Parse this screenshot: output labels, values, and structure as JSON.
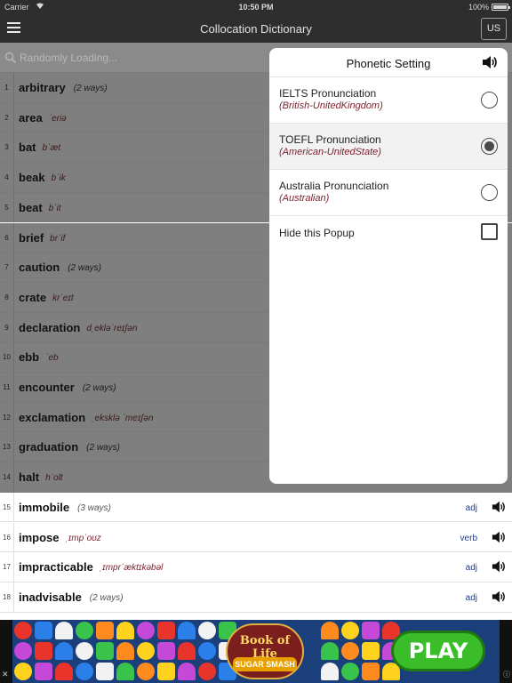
{
  "status_bar": {
    "carrier": "Carrier",
    "time": "10:50 PM",
    "battery": "100%"
  },
  "nav": {
    "title": "Collocation Dictionary",
    "locale_button": "US"
  },
  "search": {
    "placeholder": "Randomly Loading..."
  },
  "entries": [
    {
      "num": "1",
      "word": "arbitrary",
      "ways": "(2 ways)"
    },
    {
      "num": "2",
      "word": "area",
      "phonetic": "ˈeriə"
    },
    {
      "num": "3",
      "word": "bat",
      "phonetic": "bˈæt"
    },
    {
      "num": "4",
      "word": "beak",
      "phonetic": "bˈik"
    },
    {
      "num": "5",
      "word": "beat",
      "phonetic": "bˈit"
    },
    {
      "num": "6",
      "word": "brief",
      "phonetic": "brˈif"
    },
    {
      "num": "7",
      "word": "caution",
      "ways": "(2 ways)"
    },
    {
      "num": "8",
      "word": "crate",
      "phonetic": "krˈeɪt"
    },
    {
      "num": "9",
      "word": "declaration",
      "phonetic": "dˌekləˈreɪʃən"
    },
    {
      "num": "10",
      "word": "ebb",
      "phonetic": "ˈeb"
    },
    {
      "num": "11",
      "word": "encounter",
      "ways": "(2 ways)"
    },
    {
      "num": "12",
      "word": "exclamation",
      "phonetic": "ˌeksklə ˈmeɪʃən"
    },
    {
      "num": "13",
      "word": "graduation",
      "ways": "(2 ways)"
    },
    {
      "num": "14",
      "word": "halt",
      "phonetic": "hˈolt"
    },
    {
      "num": "15",
      "word": "immobile",
      "ways": "(3 ways)",
      "pos": "adj"
    },
    {
      "num": "16",
      "word": "impose",
      "phonetic": "ˌɪmpˈoʊz",
      "pos": "verb"
    },
    {
      "num": "17",
      "word": "impracticable",
      "phonetic": "ˌɪmprˈæktɪkəbəl",
      "pos": "adj"
    },
    {
      "num": "18",
      "word": "inadvisable",
      "ways": "(2 ways)",
      "pos": "adj"
    }
  ],
  "popup": {
    "title": "Phonetic Setting",
    "options": [
      {
        "label": "IELTS Pronunciation",
        "sub": "(British-UnitedKingdom)",
        "selected": false
      },
      {
        "label": "TOEFL Pronunciation",
        "sub": "(American-UnitedState)",
        "selected": true
      },
      {
        "label": "Australia Pronunciation",
        "sub": "(Australian)",
        "selected": false
      }
    ],
    "hide_label": "Hide this Popup",
    "hide_checked": false
  },
  "ad": {
    "logo_line1": "Book of Life",
    "logo_line2": "SUGAR SMASH",
    "play_label": "PLAY",
    "close_glyph": "✕",
    "info_glyph": "ⓘ"
  },
  "colors": {
    "bar": "#2e2e2e",
    "dim_row": "#7f7f7f",
    "phonetic": "#7a1f2a",
    "pos": "#1d3c8a"
  }
}
